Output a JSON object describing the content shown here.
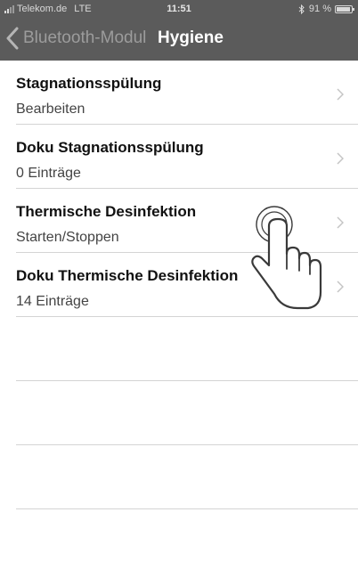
{
  "status_bar": {
    "carrier": "Telekom.de",
    "network": "LTE",
    "time": "11:51",
    "bluetooth_icon": "bluetooth-icon",
    "battery_percent": "91 %",
    "battery_level": 0.91
  },
  "nav": {
    "back_label": "Bluetooth-Modul",
    "title": "Hygiene"
  },
  "list": {
    "items": [
      {
        "title": "Stagnationsspülung",
        "subtitle": "Bearbeiten"
      },
      {
        "title": "Doku Stagnationsspülung",
        "subtitle": "0 Einträge"
      },
      {
        "title": "Thermische Desinfektion",
        "subtitle": "Starten/Stoppen"
      },
      {
        "title": "Doku Thermische Desinfektion",
        "subtitle": "14 Einträge"
      }
    ]
  },
  "colors": {
    "nav_background": "#5b5b5b",
    "separator": "#d4d4d4"
  }
}
